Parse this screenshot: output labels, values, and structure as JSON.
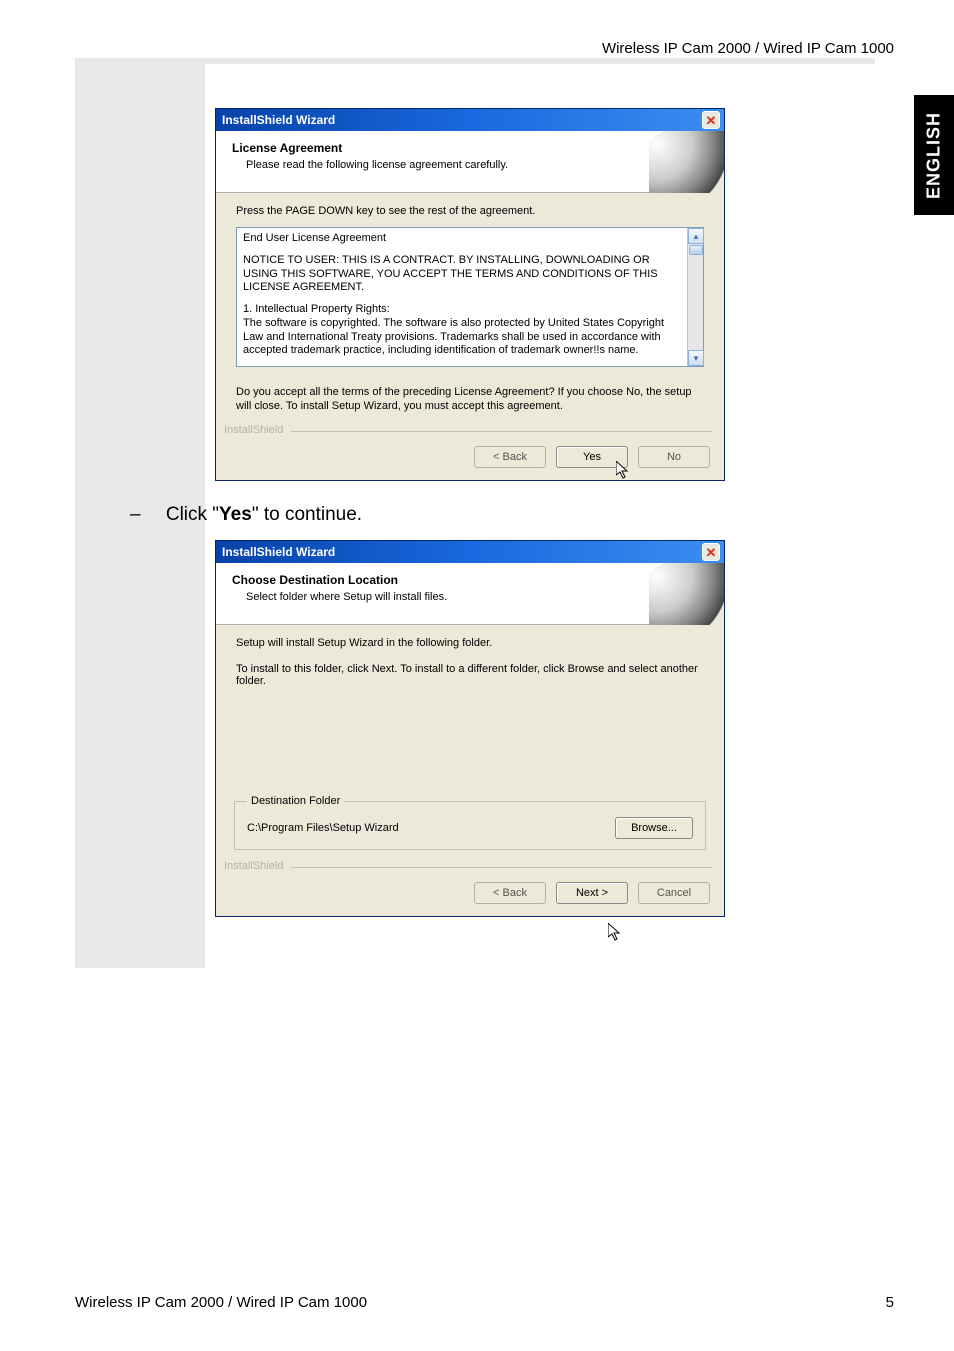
{
  "header": {
    "product": "Wireless IP Cam 2000 / Wired IP Cam 1000"
  },
  "sideTab": {
    "text": "ENGLISH"
  },
  "dialog1": {
    "title": "InstallShield Wizard",
    "bannerTitle": "License Agreement",
    "bannerSub": "Please read the following license agreement carefully.",
    "instruction": "Press the PAGE DOWN key to see the rest of the agreement.",
    "eula": {
      "line1": "End User License Agreement",
      "line2": "NOTICE TO USER:  THIS IS A CONTRACT.  BY INSTALLING, DOWNLOADING OR USING THIS SOFTWARE, YOU ACCEPT THE TERMS AND CONDITIONS OF THIS LICENSE AGREEMENT.",
      "line3": "1.  Intellectual Property Rights:",
      "line4": "The software is copyrighted.  The software is also protected by United States Copyright Law and International Treaty provisions.  Trademarks shall be used in accordance with accepted trademark practice, including identification of trademark owner!!s name."
    },
    "accept": "Do you accept all the terms of the preceding License Agreement?  If you choose No,  the setup will close.  To install Setup Wizard, you must accept this agreement.",
    "brand": "InstallShield",
    "buttons": {
      "back": "< Back",
      "yes": "Yes",
      "no": "No"
    }
  },
  "instructionText": {
    "dash": "–",
    "prefix": "Click \"",
    "bold": "Yes",
    "suffix": "\" to continue."
  },
  "dialog2": {
    "title": "InstallShield Wizard",
    "bannerTitle": "Choose Destination Location",
    "bannerSub": "Select folder where Setup will install files.",
    "line1": "Setup will install Setup Wizard in the following folder.",
    "line2": "To install to this folder, click Next. To install to a different folder, click Browse and select another folder.",
    "destLegend": "Destination Folder",
    "destPath": "C:\\Program Files\\Setup Wizard",
    "browse": "Browse...",
    "brand": "InstallShield",
    "buttons": {
      "back": "< Back",
      "next": "Next >",
      "cancel": "Cancel"
    }
  },
  "footer": {
    "left": "Wireless IP Cam 2000 / Wired IP Cam 1000",
    "pageNum": "5"
  }
}
